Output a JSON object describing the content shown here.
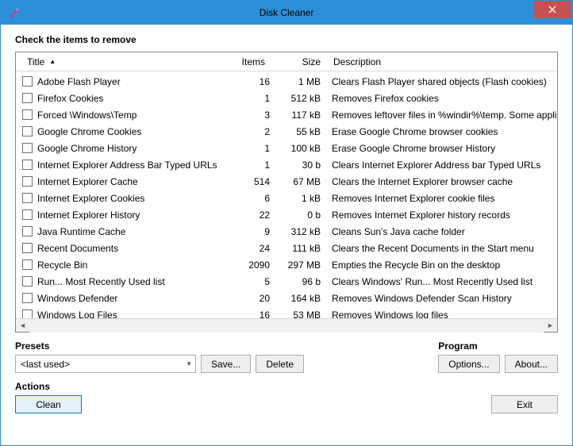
{
  "window": {
    "title": "Disk Cleaner"
  },
  "heading": "Check the items to remove",
  "columns": {
    "title": "Title",
    "items": "Items",
    "size": "Size",
    "desc": "Description"
  },
  "rows": [
    {
      "title": "Adobe Flash Player",
      "items": "16",
      "size": "1 MB",
      "desc": "Clears Flash Player shared objects (Flash cookies)"
    },
    {
      "title": "Firefox Cookies",
      "items": "1",
      "size": "512 kB",
      "desc": "Removes Firefox cookies"
    },
    {
      "title": "Forced \\Windows\\Temp",
      "items": "3",
      "size": "117 kB",
      "desc": "Removes leftover files in %windir%\\temp. Some appli"
    },
    {
      "title": "Google Chrome Cookies",
      "items": "2",
      "size": "55 kB",
      "desc": "Erase Google Chrome browser cookies"
    },
    {
      "title": "Google Chrome History",
      "items": "1",
      "size": "100 kB",
      "desc": "Erase Google Chrome browser History"
    },
    {
      "title": "Internet Explorer Address Bar Typed URLs",
      "items": "1",
      "size": "30 b",
      "desc": "Clears Internet Explorer Address bar Typed URLs"
    },
    {
      "title": "Internet Explorer Cache",
      "items": "514",
      "size": "67 MB",
      "desc": "Clears the Internet Explorer browser cache"
    },
    {
      "title": "Internet Explorer Cookies",
      "items": "6",
      "size": "1 kB",
      "desc": "Removes Internet Explorer cookie files"
    },
    {
      "title": "Internet Explorer History",
      "items": "22",
      "size": "0 b",
      "desc": "Removes Internet Explorer history records"
    },
    {
      "title": "Java Runtime Cache",
      "items": "9",
      "size": "312 kB",
      "desc": "Cleans Sun's Java cache folder"
    },
    {
      "title": "Recent Documents",
      "items": "24",
      "size": "111 kB",
      "desc": "Clears the Recent Documents in the Start menu"
    },
    {
      "title": "Recycle Bin",
      "items": "2090",
      "size": "297 MB",
      "desc": "Empties the Recycle Bin on the desktop"
    },
    {
      "title": "Run... Most Recently Used list",
      "items": "5",
      "size": "96 b",
      "desc": "Clears Windows' Run... Most Recently Used list"
    },
    {
      "title": "Windows Defender",
      "items": "20",
      "size": "164 kB",
      "desc": "Removes Windows Defender Scan History"
    },
    {
      "title": "Windows Log Files",
      "items": "16",
      "size": "53 MB",
      "desc": "Removes Windows log files"
    }
  ],
  "presets": {
    "label": "Presets",
    "selected": "<last used>",
    "save": "Save...",
    "delete": "Delete"
  },
  "program": {
    "label": "Program",
    "options": "Options...",
    "about": "About..."
  },
  "actions": {
    "label": "Actions",
    "clean": "Clean",
    "exit": "Exit"
  }
}
